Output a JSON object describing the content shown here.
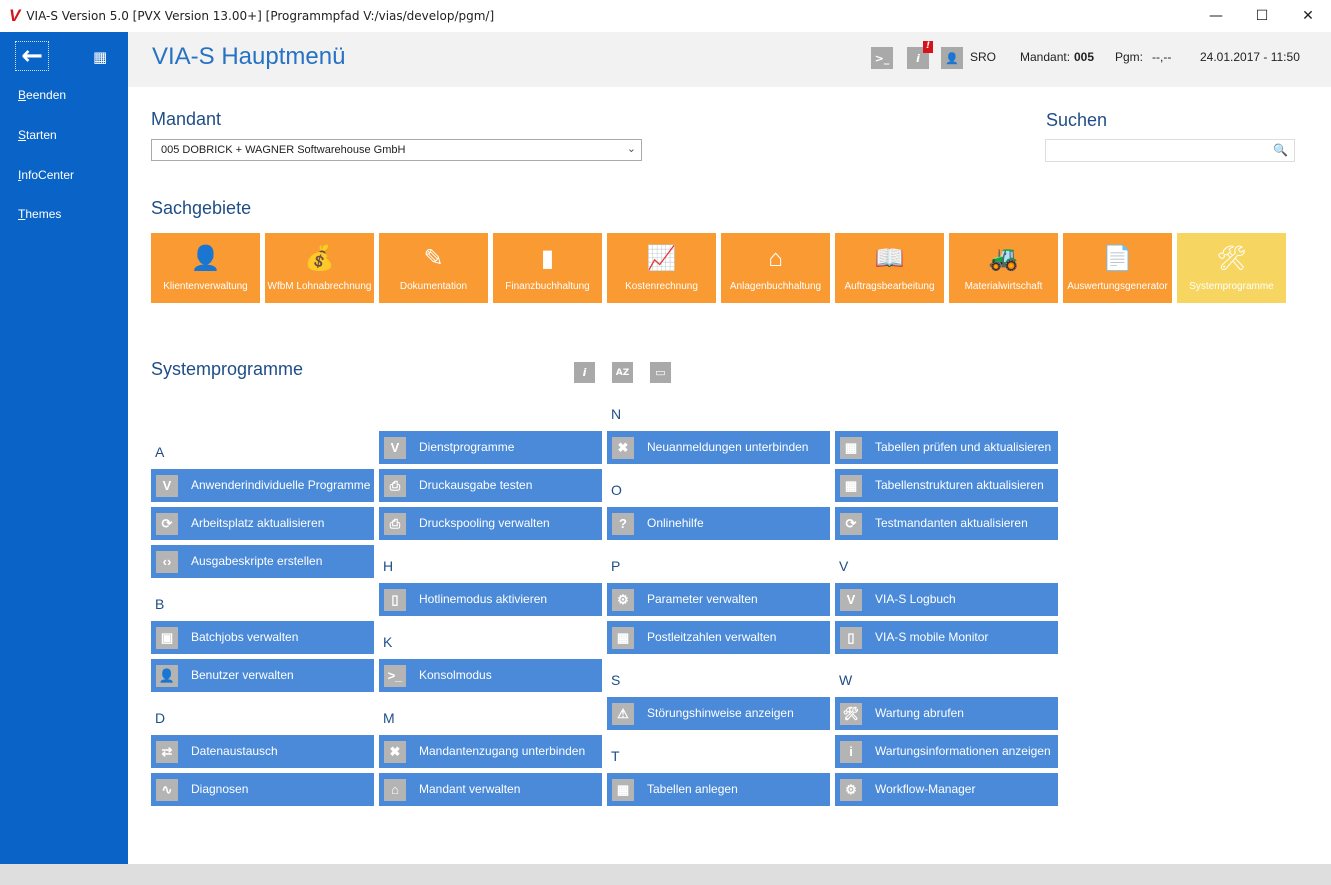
{
  "window": {
    "title": "VIA-S Version 5.0  [PVX Version  13.00+]  [Programmpfad  V:/vias/develop/pgm/]",
    "logo": "V"
  },
  "sidebar": {
    "items": [
      {
        "key": "B",
        "rest": "eenden"
      },
      {
        "key": "S",
        "rest": "tarten"
      },
      {
        "key": "I",
        "rest": "nfoCenter"
      },
      {
        "key": "T",
        "rest": "hemes"
      }
    ]
  },
  "header": {
    "title": "VIA-S Hauptmenü",
    "user": "SRO",
    "mandant_label": "Mandant:",
    "mandant_value": "005",
    "pgm_label": "Pgm:",
    "pgm_value": "--,--",
    "datetime": "24.01.2017 - 11:50"
  },
  "mandant": {
    "label": "Mandant",
    "value": "005  DOBRICK + WAGNER  Softwarehouse GmbH"
  },
  "search": {
    "label": "Suchen",
    "value": ""
  },
  "sachgebiete": {
    "label": "Sachgebiete",
    "items": [
      {
        "text": "Klientenverwaltung",
        "icon": "👤"
      },
      {
        "text": "WfbM Lohnabrechnung",
        "icon": "💰"
      },
      {
        "text": "Dokumentation",
        "icon": "✎"
      },
      {
        "text": "Finanzbuchhaltung",
        "icon": "▮"
      },
      {
        "text": "Kostenrechnung",
        "icon": "📈"
      },
      {
        "text": "Anlagenbuchhaltung",
        "icon": "⌂"
      },
      {
        "text": "Auftragsbearbeitung",
        "icon": "📖"
      },
      {
        "text": "Materialwirtschaft",
        "icon": "🚜"
      },
      {
        "text": "Auswertungsgenerator",
        "icon": "📄"
      },
      {
        "text": "Systemprogramme",
        "icon": "🛠",
        "active": true
      }
    ]
  },
  "section": {
    "title": "Systemprogramme"
  },
  "grid": [
    [
      {
        "slot": 1,
        "letter": "A"
      },
      {
        "slot": 2,
        "text": "Anwenderindividuelle Programme",
        "icon": "V"
      },
      {
        "slot": 3,
        "text": "Arbeitsplatz aktualisieren",
        "icon": "⟳"
      },
      {
        "slot": 4,
        "text": "Ausgabeskripte erstellen",
        "icon": "‹›"
      },
      {
        "slot": 5,
        "letter": "B"
      },
      {
        "slot": 6,
        "text": "Batchjobs verwalten",
        "icon": "▣"
      },
      {
        "slot": 7,
        "text": "Benutzer verwalten",
        "icon": "👤"
      },
      {
        "slot": 8,
        "letter": "D"
      },
      {
        "slot": 9,
        "text": "Datenaustausch",
        "icon": "⇄"
      },
      {
        "slot": 10,
        "text": "Diagnosen",
        "icon": "∿"
      }
    ],
    [
      {
        "slot": 1,
        "text": "Dienstprogramme",
        "icon": "V"
      },
      {
        "slot": 2,
        "text": "Druckausgabe testen",
        "icon": "⎙"
      },
      {
        "slot": 3,
        "text": "Druckspooling verwalten",
        "icon": "⎙"
      },
      {
        "slot": 4,
        "letter": "H"
      },
      {
        "slot": 5,
        "text": "Hotlinemodus aktivieren",
        "icon": "▯"
      },
      {
        "slot": 6,
        "letter": "K"
      },
      {
        "slot": 7,
        "text": "Konsolmodus",
        "icon": ">_"
      },
      {
        "slot": 8,
        "letter": "M"
      },
      {
        "slot": 9,
        "text": "Mandantenzugang unterbinden",
        "icon": "✖"
      },
      {
        "slot": 10,
        "text": "Mandant verwalten",
        "icon": "⌂"
      }
    ],
    [
      {
        "slot": 0,
        "letter": "N"
      },
      {
        "slot": 1,
        "text": "Neuanmeldungen unterbinden",
        "icon": "✖"
      },
      {
        "slot": 2,
        "letter": "O"
      },
      {
        "slot": 3,
        "text": "Onlinehilfe",
        "icon": "?"
      },
      {
        "slot": 4,
        "letter": "P"
      },
      {
        "slot": 5,
        "text": "Parameter verwalten",
        "icon": "⚙"
      },
      {
        "slot": 6,
        "text": "Postleitzahlen verwalten",
        "icon": "▦"
      },
      {
        "slot": 7,
        "letter": "S"
      },
      {
        "slot": 8,
        "text": "Störungshinweise anzeigen",
        "icon": "⚠"
      },
      {
        "slot": 9,
        "letter": "T"
      },
      {
        "slot": 10,
        "text": "Tabellen anlegen",
        "icon": "▦"
      }
    ],
    [
      {
        "slot": 1,
        "text": "Tabellen prüfen und aktualisieren",
        "icon": "▦"
      },
      {
        "slot": 2,
        "text": "Tabellenstrukturen aktualisieren",
        "icon": "▦"
      },
      {
        "slot": 3,
        "text": "Testmandanten aktualisieren",
        "icon": "⟳"
      },
      {
        "slot": 4,
        "letter": "V"
      },
      {
        "slot": 5,
        "text": "VIA-S Logbuch",
        "icon": "V"
      },
      {
        "slot": 6,
        "text": "VIA-S mobile Monitor",
        "icon": "▯"
      },
      {
        "slot": 7,
        "letter": "W"
      },
      {
        "slot": 8,
        "text": "Wartung abrufen",
        "icon": "🛠"
      },
      {
        "slot": 9,
        "text": "Wartungsinformationen anzeigen",
        "icon": "i"
      },
      {
        "slot": 10,
        "text": "Workflow-Manager",
        "icon": "⚙"
      }
    ]
  ],
  "colors": {
    "sidebar": "#0a64c8",
    "tile": "#4a8ad8",
    "category": "#f99a33",
    "category_active": "#f6d560",
    "title": "#2672c3"
  }
}
